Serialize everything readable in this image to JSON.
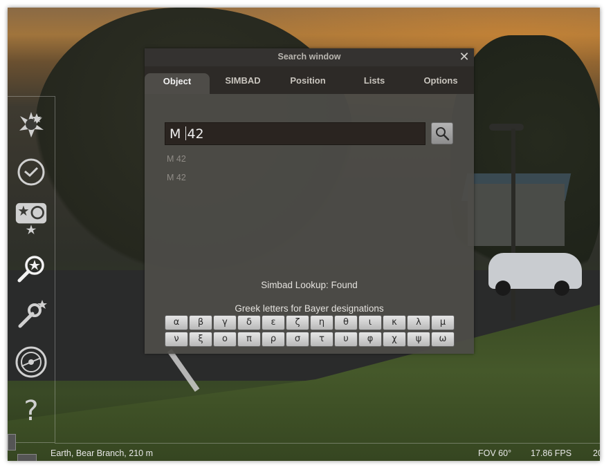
{
  "dialog": {
    "title": "Search window",
    "close_icon": "close-icon",
    "tabs": [
      {
        "label": "Object",
        "active": true
      },
      {
        "label": "SIMBAD",
        "active": false
      },
      {
        "label": "Position",
        "active": false
      },
      {
        "label": "Lists",
        "active": false
      },
      {
        "label": "Options",
        "active": false
      }
    ],
    "search": {
      "value_before_caret": "M ",
      "value_after_caret": "42"
    },
    "results": [
      "M 42",
      "M 42"
    ],
    "lookup_status": "Simbad Lookup: Found",
    "greek_label": "Greek letters for Bayer designations",
    "greek_row1": [
      "α",
      "β",
      "γ",
      "δ",
      "ε",
      "ζ",
      "η",
      "θ",
      "ι",
      "κ",
      "λ",
      "μ"
    ],
    "greek_row2": [
      "ν",
      "ξ",
      "ο",
      "π",
      "ρ",
      "σ",
      "τ",
      "υ",
      "φ",
      "χ",
      "ψ",
      "ω"
    ]
  },
  "toolbar": {
    "icons": [
      "sky-and-viewing-options-icon",
      "date-time-icon",
      "deep-sky-objects-icon",
      "search-icon",
      "configuration-icon",
      "astronomical-calculations-icon",
      "help-icon"
    ]
  },
  "status": {
    "location": "Earth, Bear Branch, 210 m",
    "fov": "FOV 60°",
    "fps": "17.86 FPS",
    "truncated": "20"
  },
  "colors": {
    "dialog_bg": "#4e4c48",
    "tabbar_bg": "#2c2926",
    "input_bg": "#2a2420",
    "status_text": "#e8e8e8"
  }
}
